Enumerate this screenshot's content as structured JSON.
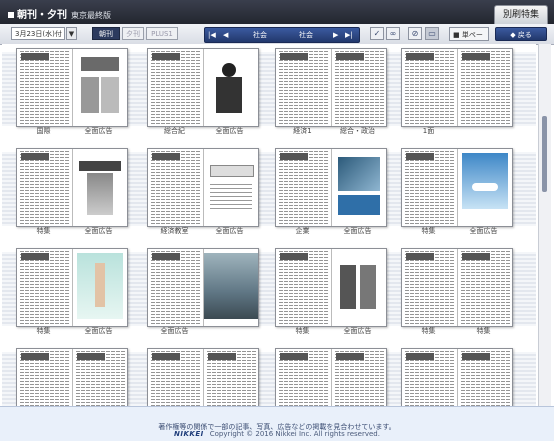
{
  "app": {
    "title": "朝刊・夕刊",
    "edition": "東京最終版",
    "special_button": "別刷特集"
  },
  "toolbar": {
    "date": "3月23日(水)付",
    "editions": [
      "朝刊",
      "夕刊",
      "PLUS1"
    ],
    "section_left": "社会",
    "section_right": "社会",
    "single_page": "単ページ",
    "back": "戻る"
  },
  "pages": [
    [
      {
        "l": "国際",
        "r": "全面広告"
      },
      {
        "l": "総合紀",
        "r": "全面広告"
      },
      {
        "l": "経済1",
        "r": "総合・政治"
      },
      {
        "l": "1面",
        "r": ""
      }
    ],
    [
      {
        "l": "特集",
        "r": "全面広告"
      },
      {
        "l": "経済教室",
        "r": "全面広告"
      },
      {
        "l": "企業",
        "r": "全面広告"
      },
      {
        "l": "特集",
        "r": "全面広告"
      }
    ],
    [
      {
        "l": "特集",
        "r": "全面広告"
      },
      {
        "l": "全面広告",
        "r": ""
      },
      {
        "l": "特集",
        "r": "全面広告"
      },
      {
        "l": "特集",
        "r": "特集"
      }
    ],
    [
      {
        "l": "",
        "r": ""
      },
      {
        "l": "",
        "r": ""
      },
      {
        "l": "",
        "r": ""
      },
      {
        "l": "",
        "r": ""
      }
    ]
  ],
  "footer": {
    "message": "著作権等の関係で一部の記事、写真、広告などの掲載を見合わせています。",
    "brand": "NIKKEI",
    "copyright": "Copyright © 2016 Nikkei Inc. All rights reserved."
  }
}
